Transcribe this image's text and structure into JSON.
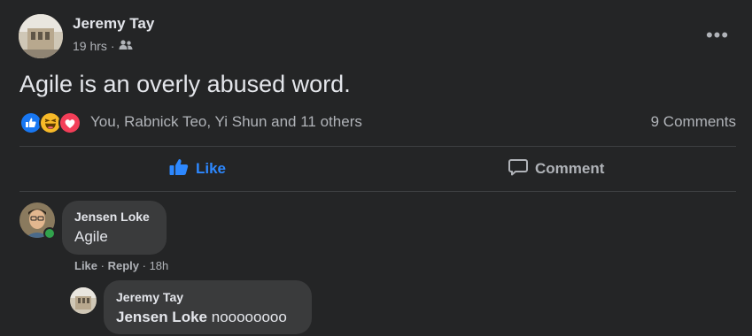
{
  "post": {
    "author": "Jeremy Tay",
    "time": "19 hrs",
    "separator": "·",
    "audience_icon": "friends-icon",
    "text": "Agile is an overly abused word.",
    "more_icon": "more-options-icon",
    "more_glyph": "•••"
  },
  "reactions": {
    "icons": [
      "like-reaction-icon",
      "haha-reaction-icon",
      "love-reaction-icon"
    ],
    "names": "You, Rabnick Teo, Yi Shun and 11 others",
    "comments_count": "9 Comments"
  },
  "actions": {
    "like_label": "Like",
    "comment_label": "Comment",
    "like_color": "#2d88ff"
  },
  "comments": [
    {
      "author": "Jensen Loke",
      "text": "Agile",
      "like_label": "Like",
      "reply_label": "Reply",
      "time": "18h",
      "online": true
    },
    {
      "author": "Jeremy Tay",
      "mention": "Jensen Loke",
      "text": "noooooooo"
    }
  ]
}
